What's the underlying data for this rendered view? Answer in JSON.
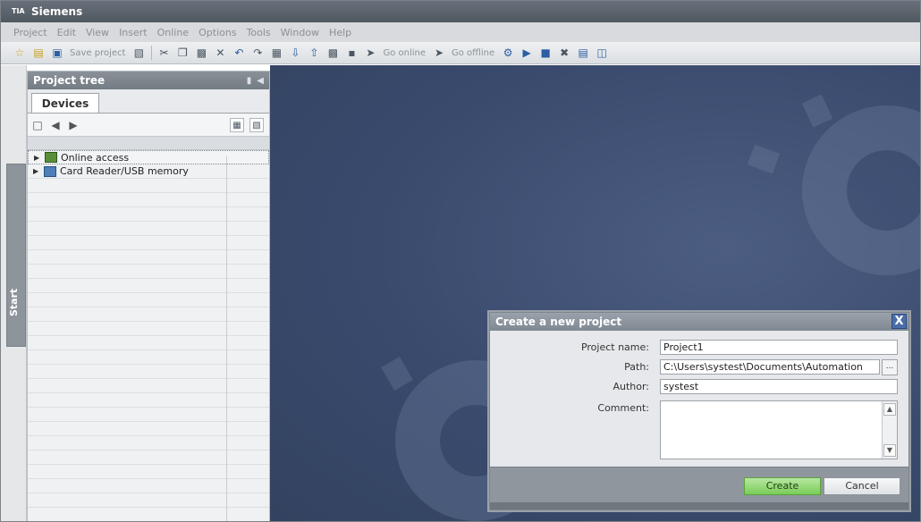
{
  "window": {
    "title": "Siemens",
    "logo_text": "TIA"
  },
  "menu": [
    "Project",
    "Edit",
    "View",
    "Insert",
    "Online",
    "Options",
    "Tools",
    "Window",
    "Help"
  ],
  "toolbar": {
    "save_label": "Save project",
    "go_online_label": "Go online",
    "go_offline_label": "Go offline"
  },
  "sidebar": {
    "start_label": "Start"
  },
  "project_tree": {
    "title": "Project tree",
    "tab": "Devices",
    "items": [
      {
        "label": "Online access"
      },
      {
        "label": "Card Reader/USB memory"
      }
    ]
  },
  "dialog": {
    "title": "Create a new project",
    "project_name_label": "Project name:",
    "project_name_value": "Project1",
    "path_label": "Path:",
    "path_value": "C:\\Users\\systest\\Documents\\Automation",
    "author_label": "Author:",
    "author_value": "systest",
    "comment_label": "Comment:",
    "comment_value": "",
    "create_label": "Create",
    "cancel_label": "Cancel",
    "browse_label": "...",
    "close_label": "X"
  }
}
